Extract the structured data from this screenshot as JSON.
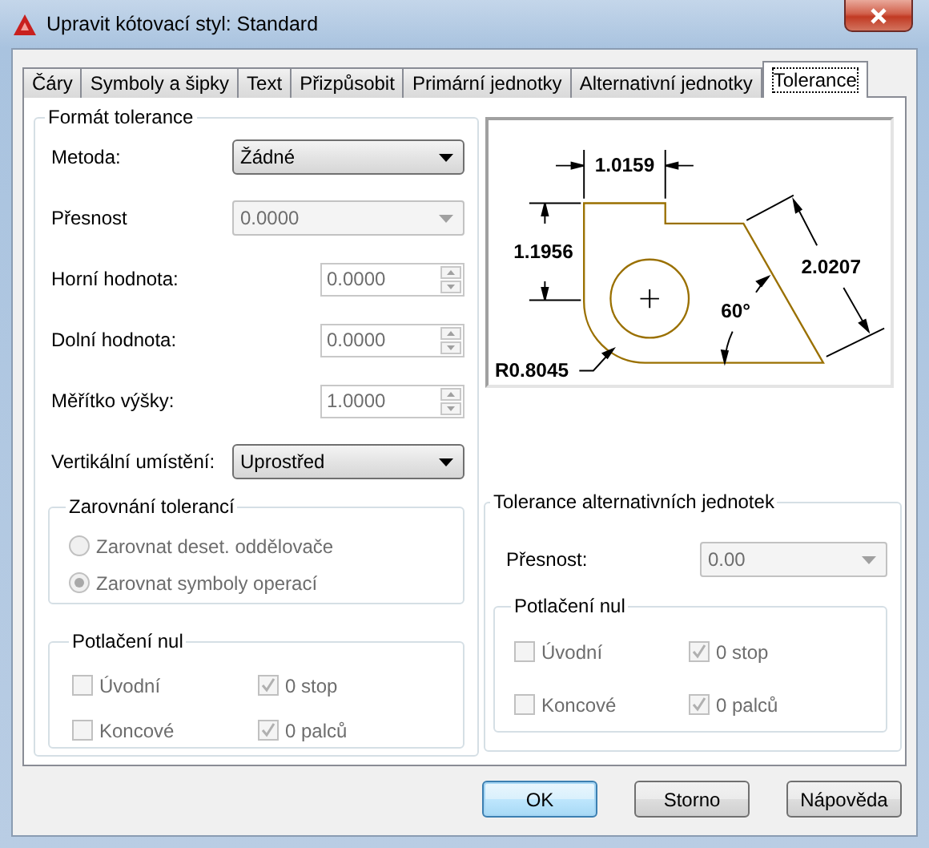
{
  "window": {
    "title": "Upravit kótovací styl: Standard"
  },
  "tabs": [
    {
      "label": "Čáry",
      "selected": false
    },
    {
      "label": "Symboly a šipky",
      "selected": false
    },
    {
      "label": "Text",
      "selected": false
    },
    {
      "label": "Přizpůsobit",
      "selected": false
    },
    {
      "label": "Primární jednotky",
      "selected": false
    },
    {
      "label": "Alternativní jednotky",
      "selected": false
    },
    {
      "label": "Tolerance",
      "selected": true
    }
  ],
  "tolerance_format": {
    "title": "Formát tolerance",
    "fields": [
      {
        "kind": "combo",
        "label": "Metoda:",
        "value": "Žádné",
        "disabled": false
      },
      {
        "kind": "combo",
        "label": "Přesnost",
        "value": "0.0000",
        "disabled": true
      },
      {
        "kind": "spin",
        "label": "Horní hodnota:",
        "value": "0.0000",
        "disabled": true
      },
      {
        "kind": "spin",
        "label": "Dolní hodnota:",
        "value": "0.0000",
        "disabled": true
      },
      {
        "kind": "spin",
        "label": "Měřítko výšky:",
        "value": "1.0000",
        "disabled": true
      },
      {
        "kind": "combo",
        "label": "Vertikální umístění:",
        "value": "Uprostřed",
        "disabled": false
      }
    ],
    "alignment": {
      "title": "Zarovnání tolerancí",
      "options": [
        {
          "label": "Zarovnat deset. oddělovače",
          "selected": false,
          "disabled": true
        },
        {
          "label": "Zarovnat symboly operací",
          "selected": true,
          "disabled": true
        }
      ]
    },
    "zero_suppression": {
      "title": "Potlačení nul",
      "options": [
        {
          "label": "Úvodní",
          "checked": false,
          "disabled": true
        },
        {
          "label": "0 stop",
          "checked": true,
          "disabled": true
        },
        {
          "label": "Koncové",
          "checked": false,
          "disabled": true
        },
        {
          "label": "0 palců",
          "checked": true,
          "disabled": true
        }
      ]
    }
  },
  "preview": {
    "labels": [
      "1.0159",
      "1.1956",
      "2.0207",
      "60°",
      "R0.8045"
    ]
  },
  "alternate_tolerance": {
    "title": "Tolerance alternativních jednotek",
    "precision": {
      "label": "Přesnost:",
      "value": "0.00",
      "disabled": true
    },
    "zero_suppression": {
      "title": "Potlačení nul",
      "options": [
        {
          "label": "Úvodní",
          "checked": false,
          "disabled": true
        },
        {
          "label": "0 stop",
          "checked": true,
          "disabled": true
        },
        {
          "label": "Koncové",
          "checked": false,
          "disabled": true
        },
        {
          "label": "0 palců",
          "checked": true,
          "disabled": true
        }
      ]
    }
  },
  "buttons": [
    {
      "label": "OK",
      "default": true
    },
    {
      "label": "Storno",
      "default": false
    },
    {
      "label": "Nápověda",
      "default": false
    }
  ]
}
